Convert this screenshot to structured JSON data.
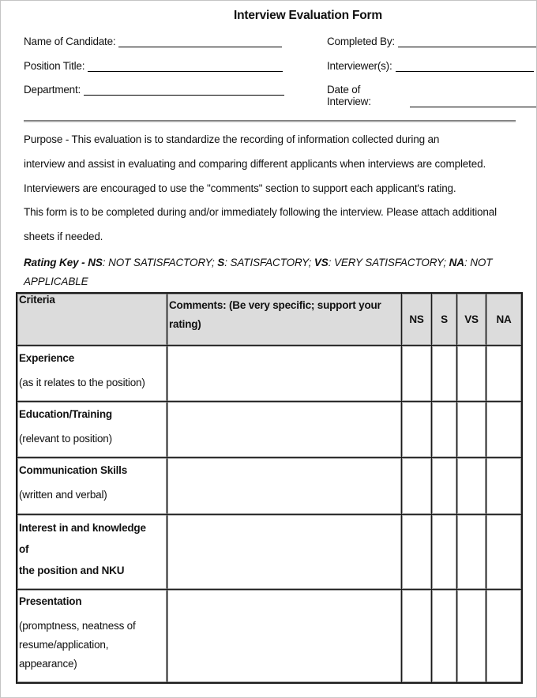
{
  "document": {
    "title": "Interview Evaluation Form",
    "fields_left": [
      {
        "label": "Name of Candidate:",
        "value": ""
      },
      {
        "label": "Position Title:",
        "value": ""
      },
      {
        "label": "Department:",
        "value": ""
      }
    ],
    "fields_right": [
      {
        "label": "Completed By:",
        "value": ""
      },
      {
        "label": "Interviewer(s):",
        "value": ""
      },
      {
        "label": "Date of Interview:",
        "value": ""
      }
    ],
    "purpose_lines": [
      "Purpose - This evaluation is to standardize the recording of information collected during an",
      "interview and assist in evaluating and comparing different applicants when interviews are completed.",
      "Interviewers are encouraged to use the \"comments\" section to support each applicant's rating.",
      "This form is to be completed during and/or immediately  following the interview. Please attach additional",
      "sheets if needed."
    ],
    "rating_key": {
      "prefix": "Rating Key - ",
      "items": [
        {
          "code": "NS",
          "meaning": ": NOT SATISFACTORY; "
        },
        {
          "code": "S",
          "meaning": ": SATISFACTORY; "
        },
        {
          "code": "VS",
          "meaning": ": VERY SATISFACTORY; "
        },
        {
          "code": "NA",
          "meaning": ": NOT APPLICABLE"
        }
      ]
    },
    "table": {
      "headers": {
        "criteria": "Criteria",
        "comments_line1": "Comments: (Be very specific; support your",
        "comments_line2": "rating)",
        "ns": "NS",
        "s": "S",
        "vs": "VS",
        "na": "NA"
      },
      "rows": [
        {
          "title": "Experience",
          "subtitle": "(as it relates to the position)"
        },
        {
          "title": "Education/Training",
          "subtitle": "(relevant to position)"
        },
        {
          "title": "Communication Skills",
          "subtitle": "(written and verbal)"
        },
        {
          "title_lines": [
            "Interest in and knowledge",
            "of",
            "the position and NKU"
          ]
        },
        {
          "title": "Presentation",
          "subtitle_lines": [
            "(promptness, neatness of",
            "resume/application,",
            "appearance)"
          ]
        }
      ]
    }
  }
}
